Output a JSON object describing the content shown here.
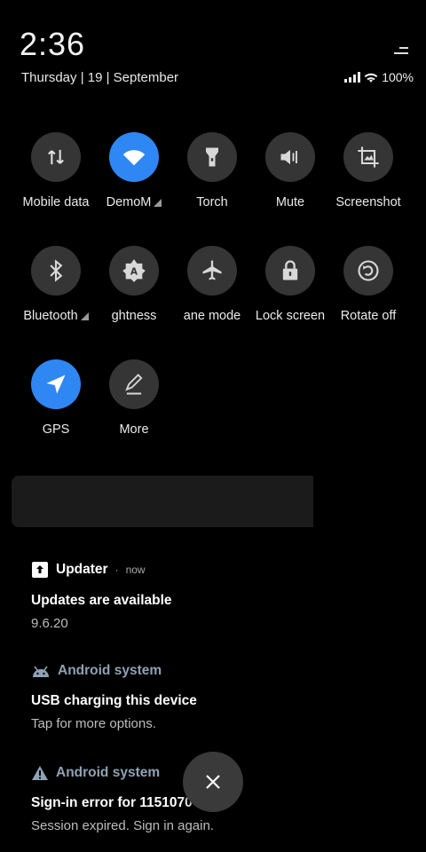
{
  "header": {
    "time": "2:36",
    "date": "Thursday | 19 | September",
    "battery": "100%"
  },
  "tiles": [
    {
      "label": "Mobile data",
      "icon": "mobile-data-icon",
      "on": false
    },
    {
      "label": "DemoM",
      "icon": "wifi-icon",
      "on": true
    },
    {
      "label": "Torch",
      "icon": "torch-icon",
      "on": false
    },
    {
      "label": "Mute",
      "icon": "mute-icon",
      "on": false
    },
    {
      "label": "Screenshot",
      "icon": "screenshot-icon",
      "on": false
    },
    {
      "label": "Bluetooth",
      "icon": "bluetooth-icon",
      "on": false
    },
    {
      "label": "ghtness",
      "icon": "brightness-icon",
      "on": false
    },
    {
      "label": "ane mode",
      "icon": "airplane-icon",
      "on": false
    },
    {
      "label": "Lock screen",
      "icon": "lock-icon",
      "on": false
    },
    {
      "label": "Rotate off",
      "icon": "rotate-icon",
      "on": false
    },
    {
      "label": "GPS",
      "icon": "gps-icon",
      "on": true
    },
    {
      "label": "More",
      "icon": "edit-icon",
      "on": false
    }
  ],
  "notifications": [
    {
      "app": "Updater",
      "when": "now",
      "title": "Updates are available",
      "text": "9.6.20"
    },
    {
      "app": "Android system",
      "title": "USB charging this device",
      "text": "Tap for more options."
    },
    {
      "app": "Android system",
      "title": "Sign-in error for 1151070",
      "text": "Session expired. Sign in again."
    }
  ],
  "colors": {
    "accent": "#2f87f3",
    "tile_off": "#353535",
    "system_app": "#8fa2b4"
  }
}
